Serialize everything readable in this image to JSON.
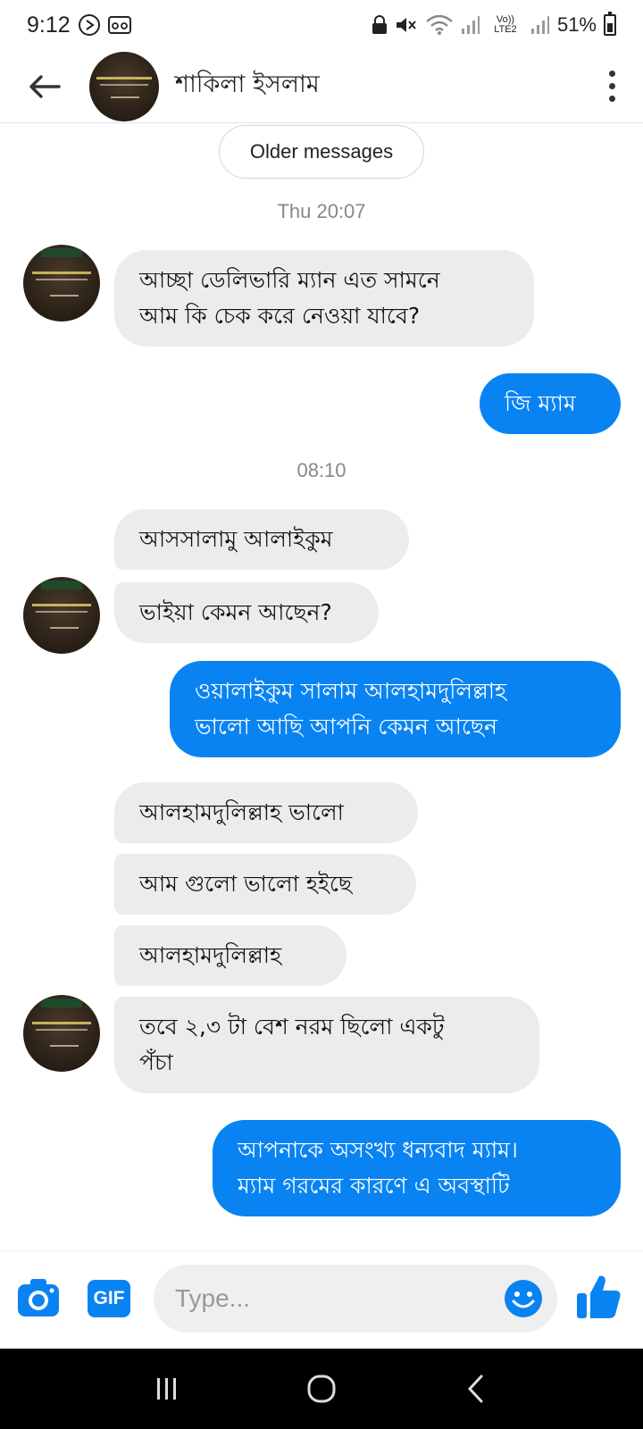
{
  "status_bar": {
    "time": "9:12",
    "network_label": "Vo)) LTE2",
    "battery": "51%"
  },
  "header": {
    "contact_name": "শাকিলা ইসলাম"
  },
  "older_messages_label": "Older messages",
  "timestamps": [
    "Thu 20:07",
    "08:10"
  ],
  "messages": [
    {
      "from": "them",
      "lines": [
        "আচ্ছা ডেলিভারি ম্যান এত সামনে",
        "আম কি চেক করে নেওয়া যাবে?"
      ]
    },
    {
      "from": "me",
      "lines": [
        "জি ম্যাম"
      ]
    },
    {
      "from": "them",
      "lines": [
        "আসসালামু আলাইকুম"
      ]
    },
    {
      "from": "them",
      "lines": [
        "ভাইয়া কেমন আছেন?"
      ]
    },
    {
      "from": "me",
      "lines": [
        "ওয়ালাইকুম সালাম আলহামদুলিল্লাহ",
        "ভালো আছি আপনি কেমন আছেন"
      ]
    },
    {
      "from": "them",
      "lines": [
        "আলহামদুলিল্লাহ ভালো"
      ]
    },
    {
      "from": "them",
      "lines": [
        "আম গুলো ভালো হইছে"
      ]
    },
    {
      "from": "them",
      "lines": [
        "আলহামদুলিল্লাহ"
      ]
    },
    {
      "from": "them",
      "lines": [
        "তবে ২,৩ টা বেশ নরম ছিলো একটু",
        "পঁচা"
      ]
    },
    {
      "from": "me",
      "lines": [
        "আপনাকে অসংখ্য ধন্যবাদ ম্যাম।",
        "ম্যাম গরমের কারণে এ অবস্থাটি"
      ]
    }
  ],
  "composer": {
    "gif_label": "GIF",
    "placeholder": "Type..."
  },
  "icons": {
    "back": "arrow-left-icon",
    "menu": "kebab-menu-icon",
    "camera": "camera-icon",
    "emoji": "emoji-icon",
    "like": "thumbs-up-icon",
    "nav_recent": "recent-apps-icon",
    "nav_home": "home-icon",
    "nav_back": "nav-back-icon"
  },
  "colors": {
    "accent": "#0a83f2",
    "incoming_bubble": "#ececec"
  }
}
